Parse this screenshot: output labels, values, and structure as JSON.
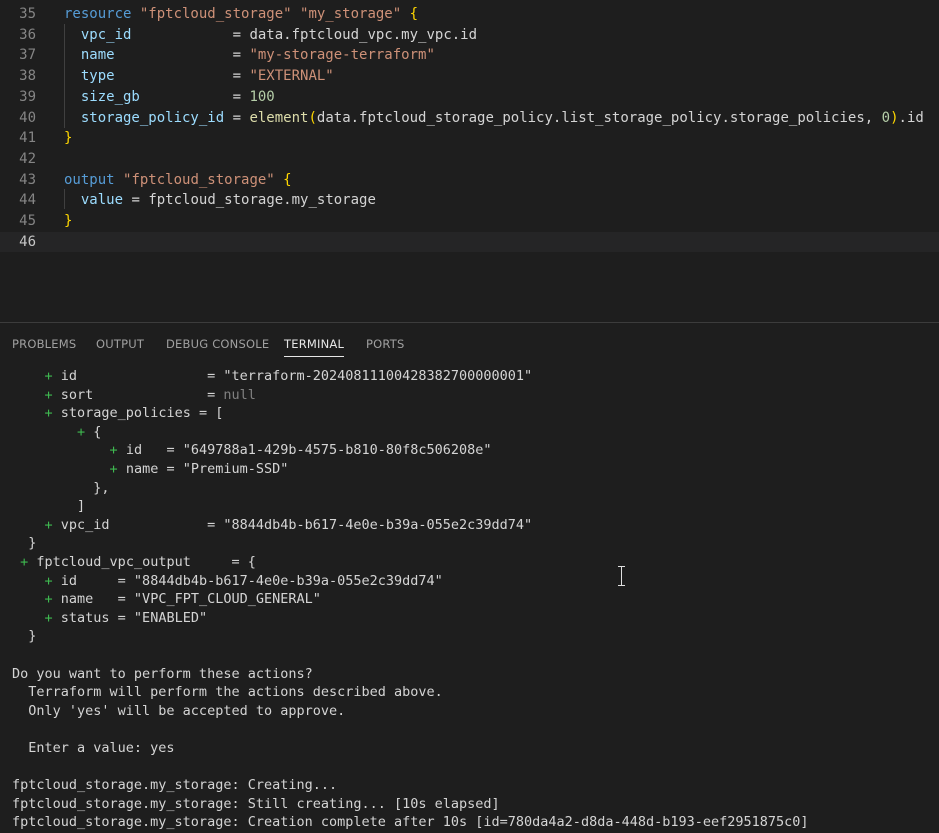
{
  "editor": {
    "lines": [
      {
        "num": "35",
        "parts": [
          [
            "k",
            "resource "
          ],
          [
            "s",
            "\"fptcloud_storage\""
          ],
          [
            "p",
            " "
          ],
          [
            "s",
            "\"my_storage\""
          ],
          [
            "p",
            " "
          ],
          [
            "b",
            "{"
          ]
        ]
      },
      {
        "num": "36",
        "parts": [
          [
            "p",
            "  "
          ],
          [
            "a",
            "vpc_id"
          ],
          [
            "p",
            "            = "
          ],
          [
            "p",
            "data.fptcloud_vpc.my_vpc.id"
          ]
        ]
      },
      {
        "num": "37",
        "parts": [
          [
            "p",
            "  "
          ],
          [
            "a",
            "name"
          ],
          [
            "p",
            "              = "
          ],
          [
            "s",
            "\"my-storage-terraform\""
          ]
        ]
      },
      {
        "num": "38",
        "parts": [
          [
            "p",
            "  "
          ],
          [
            "a",
            "type"
          ],
          [
            "p",
            "              = "
          ],
          [
            "s",
            "\"EXTERNAL\""
          ]
        ]
      },
      {
        "num": "39",
        "parts": [
          [
            "p",
            "  "
          ],
          [
            "a",
            "size_gb"
          ],
          [
            "p",
            "           = "
          ],
          [
            "n",
            "100"
          ]
        ]
      },
      {
        "num": "40",
        "parts": [
          [
            "p",
            "  "
          ],
          [
            "a",
            "storage_policy_id"
          ],
          [
            "p",
            " = "
          ],
          [
            "f",
            "element"
          ],
          [
            "b",
            "("
          ],
          [
            "p",
            "data.fptcloud_storage_policy.list_storage_policy.storage_policies, "
          ],
          [
            "n",
            "0"
          ],
          [
            "b",
            ")"
          ],
          [
            "p",
            ".id"
          ]
        ]
      },
      {
        "num": "41",
        "parts": [
          [
            "b",
            "}"
          ]
        ]
      },
      {
        "num": "42",
        "parts": []
      },
      {
        "num": "43",
        "parts": [
          [
            "k",
            "output "
          ],
          [
            "s",
            "\"fptcloud_storage\""
          ],
          [
            "p",
            " "
          ],
          [
            "b",
            "{"
          ]
        ]
      },
      {
        "num": "44",
        "parts": [
          [
            "p",
            "  "
          ],
          [
            "a",
            "value"
          ],
          [
            "p",
            " = "
          ],
          [
            "p",
            "fptcloud_storage.my_storage"
          ]
        ]
      },
      {
        "num": "45",
        "parts": [
          [
            "b",
            "}"
          ]
        ]
      },
      {
        "num": "46",
        "parts": []
      }
    ]
  },
  "panel_tabs": [
    {
      "label": "PROBLEMS",
      "active": false
    },
    {
      "label": "OUTPUT",
      "active": false
    },
    {
      "label": "DEBUG CONSOLE",
      "active": false
    },
    {
      "label": "TERMINAL",
      "active": true
    },
    {
      "label": "PORTS",
      "active": false
    }
  ],
  "terminal": {
    "lines": [
      [
        [
          "p",
          "    "
        ],
        [
          "plus",
          "+"
        ],
        [
          "p",
          " id                = \"terraform-20240811100428382700000001\""
        ]
      ],
      [
        [
          "p",
          "    "
        ],
        [
          "plus",
          "+"
        ],
        [
          "p",
          " sort              = "
        ],
        [
          "null",
          "null"
        ]
      ],
      [
        [
          "p",
          "    "
        ],
        [
          "plus",
          "+"
        ],
        [
          "p",
          " storage_policies = ["
        ]
      ],
      [
        [
          "p",
          "        "
        ],
        [
          "plus",
          "+"
        ],
        [
          "p",
          " {"
        ]
      ],
      [
        [
          "p",
          "            "
        ],
        [
          "plus",
          "+"
        ],
        [
          "p",
          " id   = \"649788a1-429b-4575-b810-80f8c506208e\""
        ]
      ],
      [
        [
          "p",
          "            "
        ],
        [
          "plus",
          "+"
        ],
        [
          "p",
          " name = \"Premium-SSD\""
        ]
      ],
      [
        [
          "p",
          "          },"
        ]
      ],
      [
        [
          "p",
          "        ]"
        ]
      ],
      [
        [
          "p",
          "    "
        ],
        [
          "plus",
          "+"
        ],
        [
          "p",
          " vpc_id            = \"8844db4b-b617-4e0e-b39a-055e2c39dd74\""
        ]
      ],
      [
        [
          "p",
          "  }"
        ]
      ],
      [
        [
          "p",
          " "
        ],
        [
          "plus",
          "+"
        ],
        [
          "p",
          " fptcloud_vpc_output     = {"
        ]
      ],
      [
        [
          "p",
          "    "
        ],
        [
          "plus",
          "+"
        ],
        [
          "p",
          " id     = \"8844db4b-b617-4e0e-b39a-055e2c39dd74\""
        ]
      ],
      [
        [
          "p",
          "    "
        ],
        [
          "plus",
          "+"
        ],
        [
          "p",
          " name   = \"VPC_FPT_CLOUD_GENERAL\""
        ]
      ],
      [
        [
          "p",
          "    "
        ],
        [
          "plus",
          "+"
        ],
        [
          "p",
          " status = \"ENABLED\""
        ]
      ],
      [
        [
          "p",
          "  }"
        ]
      ],
      [],
      [
        [
          "p",
          "Do you want to perform these actions?"
        ]
      ],
      [
        [
          "p",
          "  Terraform will perform the actions described above."
        ]
      ],
      [
        [
          "p",
          "  Only 'yes' will be accepted to approve."
        ]
      ],
      [],
      [
        [
          "p",
          "  Enter a value: yes"
        ]
      ],
      [],
      [
        [
          "p",
          "fptcloud_storage.my_storage: Creating..."
        ]
      ],
      [
        [
          "p",
          "fptcloud_storage.my_storage: Still creating... [10s elapsed]"
        ]
      ],
      [
        [
          "p",
          "fptcloud_storage.my_storage: Creation complete after 10s [id=780da4a2-d8da-448d-b193-eef2951875c0]"
        ]
      ]
    ]
  }
}
